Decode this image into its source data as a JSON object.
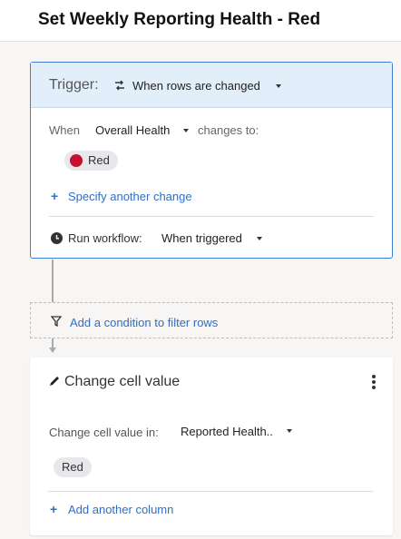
{
  "header": {
    "title": "Set Weekly Reporting Health - Red"
  },
  "trigger": {
    "label": "Trigger:",
    "icon": "swap-arrows-icon",
    "value": "When rows are changed",
    "when_label": "When",
    "column": "Overall Health",
    "changes_to": "changes to:",
    "value_pill": "Red",
    "pill_color": "#c8102e",
    "specify_link": "Specify another change",
    "run_label": "Run workflow:",
    "run_value": "When triggered"
  },
  "condition": {
    "link": "Add a condition to filter rows",
    "icon": "filter-icon"
  },
  "action": {
    "title": "Change cell value",
    "icon": "pencil-icon",
    "in_label": "Change cell value in:",
    "column": "Reported Health..",
    "value_pill": "Red",
    "add_link": "Add another column"
  },
  "colors": {
    "accent": "#2f6fc6",
    "trigger_border": "#3f7fd2",
    "trigger_header_bg": "#e3eefb",
    "red_status": "#c8102e"
  }
}
